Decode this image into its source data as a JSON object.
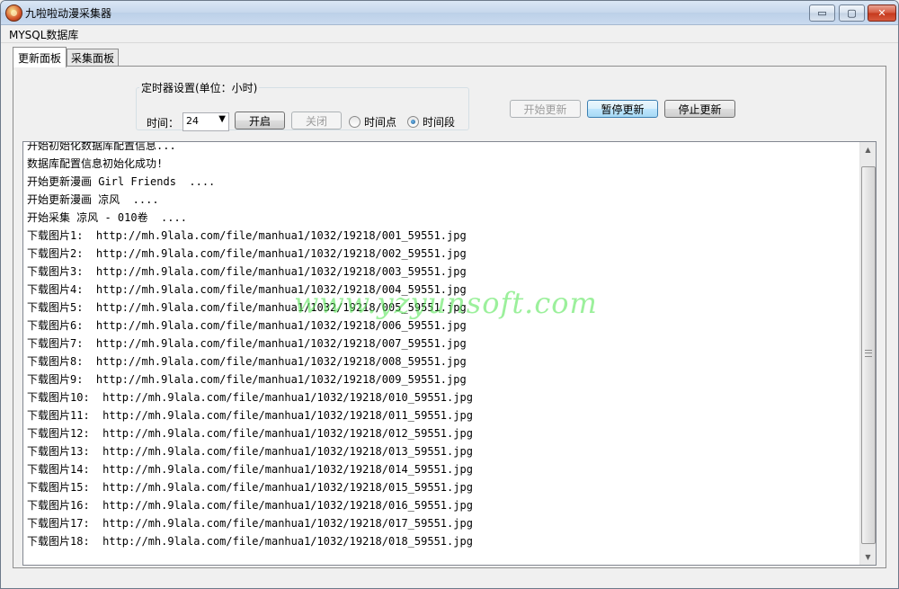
{
  "window": {
    "title": "九啦啦动漫采集器",
    "controls": {
      "minimize": "▭",
      "maximize": "▢",
      "close": "✕"
    }
  },
  "menu": {
    "items": [
      "MYSQL数据库"
    ]
  },
  "tabs": [
    {
      "label": "更新面板",
      "active": true
    },
    {
      "label": "采集面板",
      "active": false
    }
  ],
  "timer": {
    "legend": "定时器设置(单位：小时)",
    "time_label": "时间：",
    "time_value": "24",
    "open_label": "开启",
    "close_label": "关闭",
    "radio_point": "时间点",
    "radio_range": "时间段"
  },
  "actions": {
    "start_label": "开始更新",
    "pause_label": "暂停更新",
    "stop_label": "停止更新"
  },
  "log": [
    "开始初始化数据库配置信息...",
    "数据库配置信息初始化成功!",
    "开始更新漫画 Girl Friends  ....",
    "开始更新漫画 凉风  ....",
    "开始采集 凉风 - 010卷  ....",
    "下载图片1:  http://mh.9lala.com/file/manhua1/1032/19218/001_59551.jpg",
    "下载图片2:  http://mh.9lala.com/file/manhua1/1032/19218/002_59551.jpg",
    "下载图片3:  http://mh.9lala.com/file/manhua1/1032/19218/003_59551.jpg",
    "下载图片4:  http://mh.9lala.com/file/manhua1/1032/19218/004_59551.jpg",
    "下载图片5:  http://mh.9lala.com/file/manhua1/1032/19218/005_59551.jpg",
    "下载图片6:  http://mh.9lala.com/file/manhua1/1032/19218/006_59551.jpg",
    "下载图片7:  http://mh.9lala.com/file/manhua1/1032/19218/007_59551.jpg",
    "下载图片8:  http://mh.9lala.com/file/manhua1/1032/19218/008_59551.jpg",
    "下载图片9:  http://mh.9lala.com/file/manhua1/1032/19218/009_59551.jpg",
    "下载图片10:  http://mh.9lala.com/file/manhua1/1032/19218/010_59551.jpg",
    "下载图片11:  http://mh.9lala.com/file/manhua1/1032/19218/011_59551.jpg",
    "下载图片12:  http://mh.9lala.com/file/manhua1/1032/19218/012_59551.jpg",
    "下载图片13:  http://mh.9lala.com/file/manhua1/1032/19218/013_59551.jpg",
    "下载图片14:  http://mh.9lala.com/file/manhua1/1032/19218/014_59551.jpg",
    "下载图片15:  http://mh.9lala.com/file/manhua1/1032/19218/015_59551.jpg",
    "下载图片16:  http://mh.9lala.com/file/manhua1/1032/19218/016_59551.jpg",
    "下载图片17:  http://mh.9lala.com/file/manhua1/1032/19218/017_59551.jpg",
    "下载图片18:  http://mh.9lala.com/file/manhua1/1032/19218/018_59551.jpg"
  ],
  "scrollbar": {
    "up_icon": "▲",
    "down_icon": "▼"
  },
  "watermark": "www.yzyunsoft.com",
  "colors": {
    "watermark": "#5ae65a",
    "titlebar": "#c6d7ec",
    "close_button": "#c5381c"
  }
}
